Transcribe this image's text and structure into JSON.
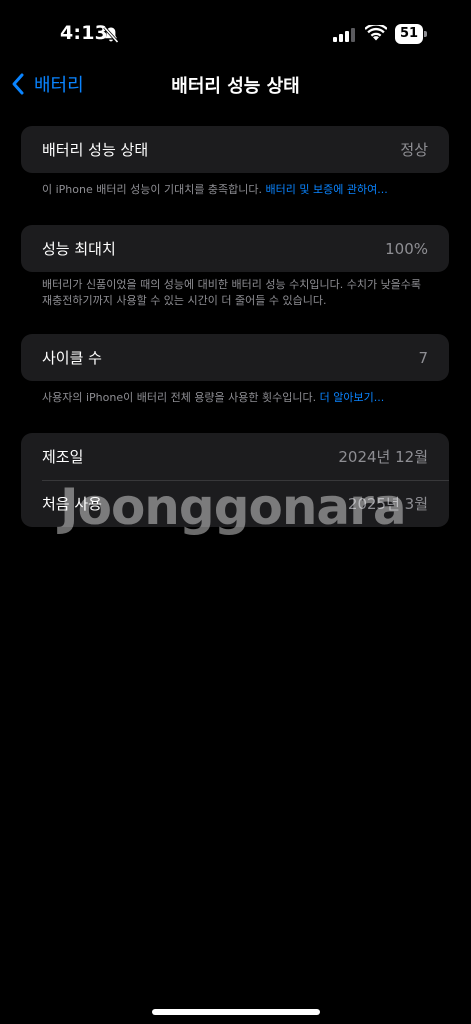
{
  "status_bar": {
    "time": "4:13",
    "battery_level": "51",
    "icons": [
      "bell-slash-icon",
      "signal-icon",
      "wifi-icon",
      "battery-icon"
    ]
  },
  "nav": {
    "back_label": "배터리",
    "title": "배터리 성능 상태"
  },
  "battery_health": {
    "label": "배터리 성능 상태",
    "value": "정상",
    "footnote": "이 iPhone 배터리 성능이 기대치를 충족합니다. ",
    "footnote_link": "배터리 및 보증에 관하여..."
  },
  "max_capacity": {
    "label": "성능 최대치",
    "value": "100%",
    "footnote": "배터리가 신품이었을 때의 성능에 대비한 배터리 성능 수치입니다. 수치가 낮을수록 재충전하기까지 사용할 수 있는 시간이 더 줄어들 수 있습니다."
  },
  "cycle_count": {
    "label": "사이클 수",
    "value": "7",
    "footnote": "사용자의 iPhone이 배터리 전체 용량을 사용한 횟수입니다. ",
    "footnote_link": "더 알아보기..."
  },
  "dates": {
    "manufacture_label": "제조일",
    "manufacture_value": "2024년 12월",
    "first_use_label": "처음 사용",
    "first_use_value": "2025년 3월"
  },
  "watermark": "Joonggonara",
  "colors": {
    "background": "#000000",
    "cell": "#1c1c1e",
    "accent": "#0a84ff",
    "secondary_text": "#8e8e93"
  }
}
